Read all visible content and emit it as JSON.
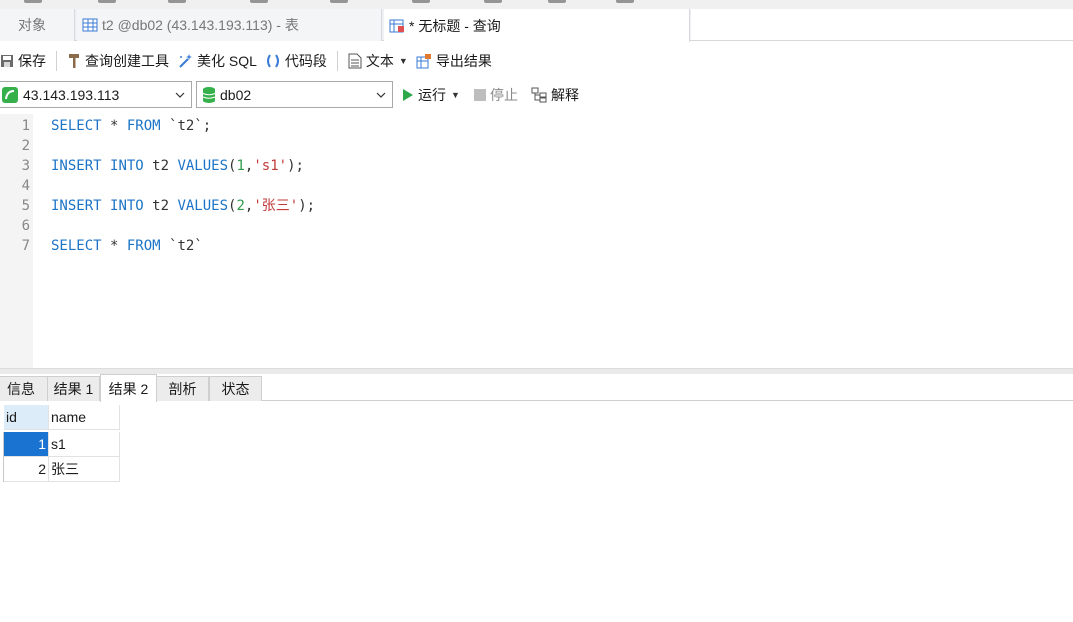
{
  "tabs": {
    "objects": "对象",
    "table_tab": "t2 @db02 (43.143.193.113) - 表",
    "query_tab": "* 无标题 - 查询"
  },
  "toolbar": {
    "save": "保存",
    "query_builder": "查询创建工具",
    "beautify": "美化 SQL",
    "snippet": "代码段",
    "text": "文本",
    "export": "导出结果"
  },
  "connection": {
    "host": "43.143.193.113",
    "database": "db02",
    "run": "运行",
    "stop": "停止",
    "explain": "解释"
  },
  "editor": {
    "line_numbers": [
      "1",
      "2",
      "3",
      "4",
      "5",
      "6",
      "7"
    ],
    "lines": [
      "SELECT * FROM `t2`;",
      "",
      "INSERT INTO t2 VALUES(1,'s1');",
      "",
      "INSERT INTO t2 VALUES(2,'张三');",
      "",
      "SELECT * FROM `t2`"
    ]
  },
  "result_tabs": {
    "info": "信息",
    "result1": "结果 1",
    "result2": "结果 2",
    "profile": "剖析",
    "status": "状态",
    "active": "结果 2"
  },
  "grid": {
    "columns": [
      "id",
      "name"
    ],
    "rows": [
      {
        "id": "1",
        "name": "s1"
      },
      {
        "id": "2",
        "name": "张三"
      }
    ]
  },
  "colors": {
    "keyword": "#1c74c7",
    "number": "#2e9a4a",
    "string": "#c23a3a",
    "selection": "#1a73d0"
  }
}
